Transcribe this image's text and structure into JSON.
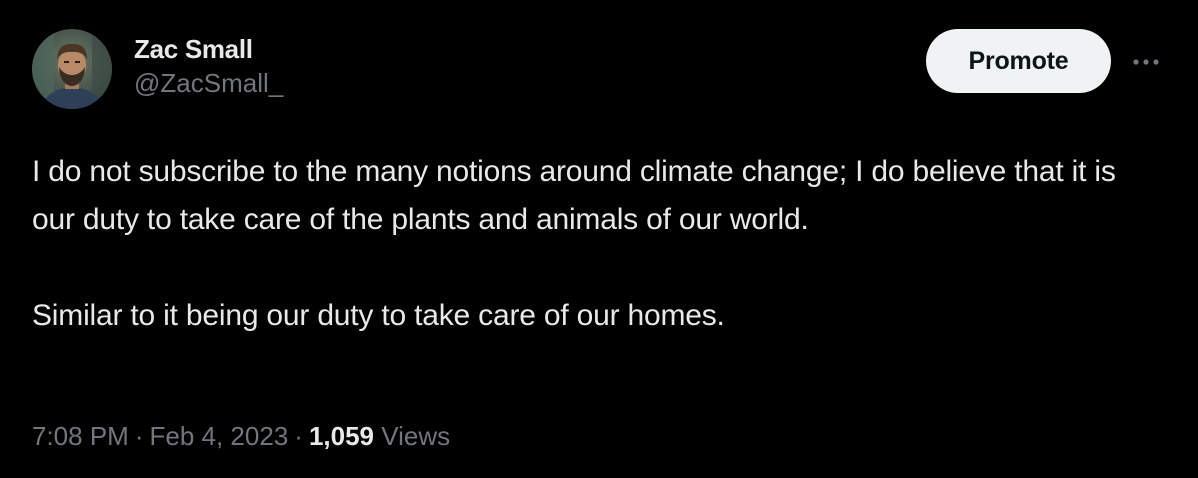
{
  "author": {
    "display_name": "Zac Small",
    "handle": "@ZacSmall_"
  },
  "actions": {
    "promote_label": "Promote",
    "more_icon": "more-horizontal-icon"
  },
  "tweet": {
    "paragraphs": [
      "I do not subscribe to the many notions around climate change; I do believe that it is our duty to take care of the plants and animals of our world.",
      "Similar to it being our duty to take care of our homes."
    ]
  },
  "meta": {
    "time": "7:08 PM",
    "separator": "·",
    "date": "Feb 4, 2023",
    "views_count": "1,059",
    "views_label": "Views"
  },
  "colors": {
    "background": "#000000",
    "primary_text": "#e7e9ea",
    "secondary_text": "#71767b",
    "button_bg": "#eff3f4",
    "button_text": "#0f1419"
  }
}
